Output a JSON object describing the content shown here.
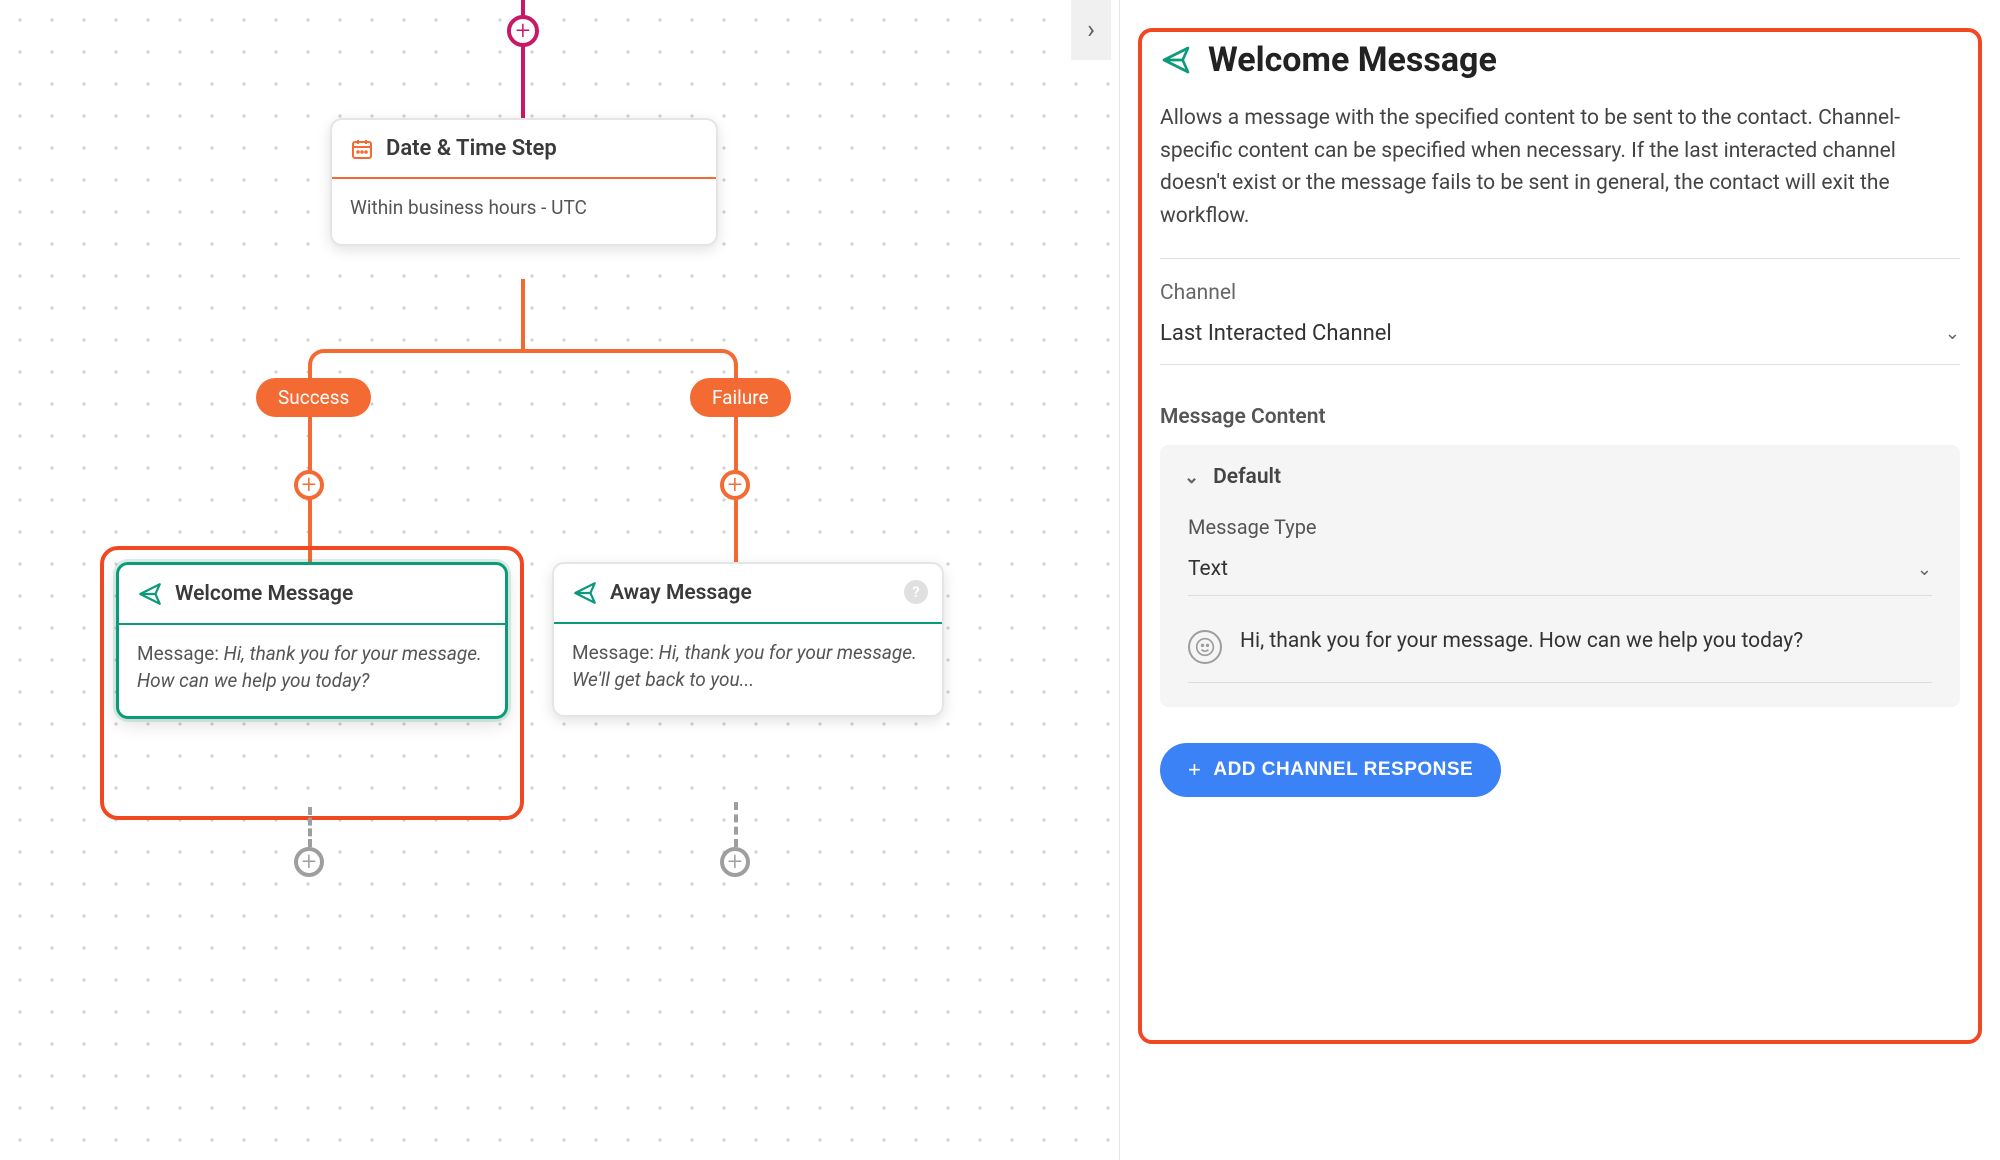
{
  "canvas": {
    "date_step": {
      "title": "Date & Time Step",
      "subtitle": "Within business hours - UTC"
    },
    "branches": {
      "success_label": "Success",
      "failure_label": "Failure"
    },
    "welcome": {
      "title": "Welcome Message",
      "body_label": "Message: ",
      "body_text": "Hi, thank you for your message. How can we help you today?"
    },
    "away": {
      "title": "Away Message",
      "body_label": "Message: ",
      "body_text": "Hi, thank you for your message. We'll get back to you..."
    }
  },
  "panel": {
    "title": "Welcome Message",
    "description": "Allows a message with the specified content to be sent to the contact. Channel-specific content can be specified when necessary. If the last interacted channel doesn't exist or the message fails to be sent in general, the contact will exit the workflow.",
    "channel_label": "Channel",
    "channel_value": "Last Interacted Channel",
    "content_heading": "Message Content",
    "default_section": "Default",
    "message_type_label": "Message Type",
    "message_type_value": "Text",
    "message_text": "Hi, thank you for your message. How can we help you today?",
    "add_channel_button": "ADD CHANNEL RESPONSE"
  }
}
